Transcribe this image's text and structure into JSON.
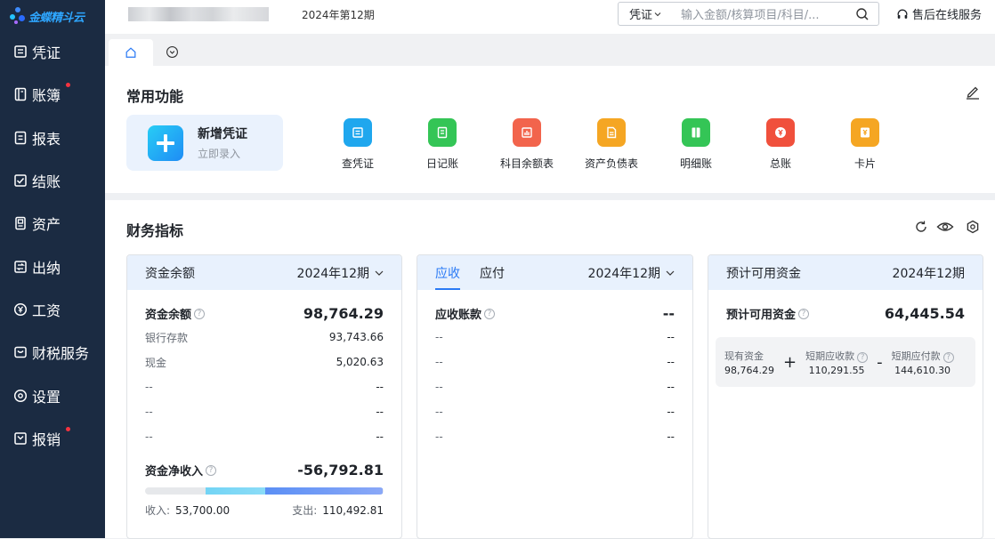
{
  "app": {
    "logo_text": "金蝶精斗云",
    "period_title": "2024年第12期"
  },
  "sidebar": {
    "items": [
      {
        "label": "凭证",
        "icon": "voucher-icon",
        "badge": false
      },
      {
        "label": "账簿",
        "icon": "ledger-icon",
        "badge": true
      },
      {
        "label": "报表",
        "icon": "report-icon",
        "badge": false
      },
      {
        "label": "结账",
        "icon": "closing-icon",
        "badge": false
      },
      {
        "label": "资产",
        "icon": "asset-icon",
        "badge": false
      },
      {
        "label": "出纳",
        "icon": "cashier-icon",
        "badge": false
      },
      {
        "label": "工资",
        "icon": "yen-icon",
        "badge": false
      },
      {
        "label": "财税服务",
        "icon": "tax-service-icon",
        "badge": false
      },
      {
        "label": "设置",
        "icon": "settings-icon",
        "badge": false
      },
      {
        "label": "报销",
        "icon": "reimburse-icon",
        "badge": true
      }
    ]
  },
  "search": {
    "type": "凭证",
    "placeholder": "输入金额/核算项目/科目/..."
  },
  "service": {
    "label": "售后在线服务"
  },
  "common": {
    "title": "常用功能",
    "new_voucher": {
      "title": "新增凭证",
      "subtitle": "立即录入"
    },
    "functions": [
      {
        "label": "查凭证",
        "color": "#1fa7ee",
        "icon": "list-icon"
      },
      {
        "label": "日记账",
        "color": "#34c556",
        "icon": "journal-icon"
      },
      {
        "label": "科目余额表",
        "color": "#f2644c",
        "icon": "bar-chart-icon"
      },
      {
        "label": "资产负债表",
        "color": "#f5a623",
        "icon": "doc-icon"
      },
      {
        "label": "明细账",
        "color": "#34c556",
        "icon": "book-icon"
      },
      {
        "label": "总账",
        "color": "#f0503c",
        "icon": "yen-circle-icon"
      },
      {
        "label": "卡片",
        "color": "#f5a623",
        "icon": "card-icon"
      }
    ]
  },
  "finance": {
    "title": "财务指标",
    "fund": {
      "title": "资金余额",
      "period": "2024年12期",
      "main_label": "资金余额",
      "main_value": "98,764.29",
      "rows": [
        {
          "label": "银行存款",
          "value": "93,743.66"
        },
        {
          "label": "现金",
          "value": "5,020.63"
        },
        {
          "label": "--",
          "value": "--"
        },
        {
          "label": "--",
          "value": "--"
        },
        {
          "label": "--",
          "value": "--"
        }
      ],
      "net_label": "资金净收入",
      "net_value": "-56,792.81",
      "income_label": "收入:",
      "income_value": "53,700.00",
      "expense_label": "支出:",
      "expense_value": "110,492.81",
      "income_share": 0.327
    },
    "receivable": {
      "tab_active": "应收",
      "tab_other": "应付",
      "period": "2024年12期",
      "main_label": "应收账款",
      "main_value": "--",
      "rows": [
        {
          "label": "--",
          "value": "--"
        },
        {
          "label": "--",
          "value": "--"
        },
        {
          "label": "--",
          "value": "--"
        },
        {
          "label": "--",
          "value": "--"
        },
        {
          "label": "--",
          "value": "--"
        }
      ]
    },
    "forecast": {
      "title": "预计可用资金",
      "period": "2024年12期",
      "main_label": "预计可用资金",
      "main_value": "64,445.54",
      "formula": [
        {
          "label": "现有资金",
          "value": "98,764.29"
        },
        {
          "op": "+"
        },
        {
          "label": "短期应收款",
          "value": "110,291.55"
        },
        {
          "op": "-"
        },
        {
          "label": "短期应付款",
          "value": "144,610.30"
        }
      ]
    }
  }
}
